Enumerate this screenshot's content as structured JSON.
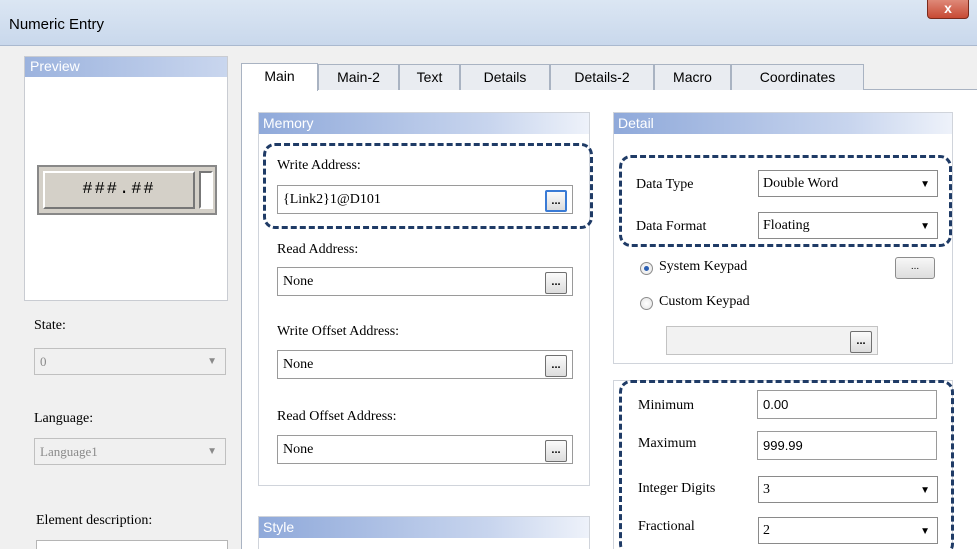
{
  "window": {
    "title": "Numeric Entry",
    "close_label": "x"
  },
  "preview": {
    "header": "Preview",
    "display_text": "###.##"
  },
  "left": {
    "state_label": "State:",
    "state_value": "0",
    "language_label": "Language:",
    "language_value": "Language1",
    "element_description_label": "Element description:"
  },
  "tabs": [
    "Main",
    "Main-2",
    "Text",
    "Details",
    "Details-2",
    "Macro",
    "Coordinates"
  ],
  "memory": {
    "header": "Memory",
    "write_address_label": "Write Address:",
    "write_address_value": "{Link2}1@D101",
    "read_address_label": "Read Address:",
    "read_address_value": "None",
    "write_offset_label": "Write Offset Address:",
    "write_offset_value": "None",
    "read_offset_label": "Read Offset Address:",
    "read_offset_value": "None",
    "browse_label": "..."
  },
  "style": {
    "header": "Style"
  },
  "detail": {
    "header": "Detail",
    "data_type_label": "Data Type",
    "data_type_value": "Double Word",
    "data_format_label": "Data Format",
    "data_format_value": "Floating",
    "system_keypad_label": "System Keypad",
    "custom_keypad_label": "Custom Keypad",
    "keypad_button_label": "...",
    "minimum_label": "Minimum",
    "minimum_value": "0.00",
    "maximum_label": "Maximum",
    "maximum_value": "999.99",
    "integer_digits_label": "Integer Digits",
    "integer_digits_value": "3",
    "fractional_label": "Fractional",
    "fractional_value": "2"
  }
}
